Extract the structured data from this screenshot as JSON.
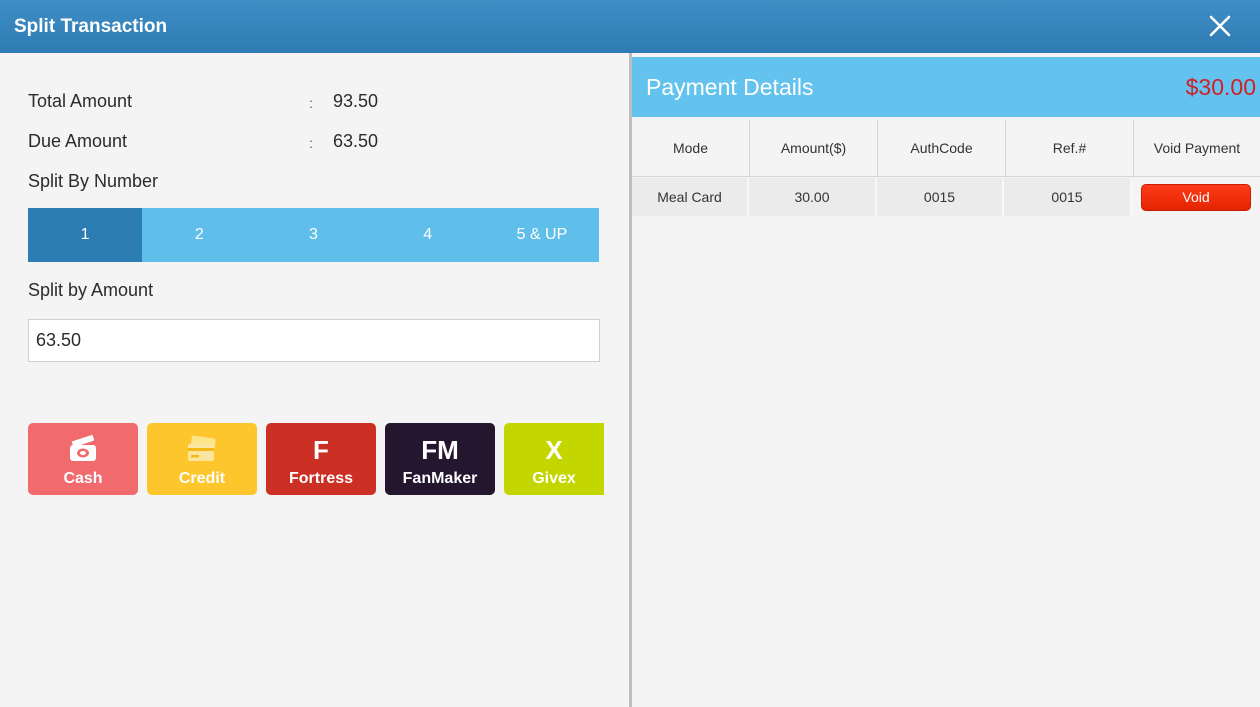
{
  "window": {
    "title": "Split Transaction",
    "close_icon": "close-icon"
  },
  "summary": {
    "total_label": "Total Amount",
    "total_colon": ":",
    "total_value": "93.50",
    "due_label": "Due Amount",
    "due_colon": ":",
    "due_value": "63.50"
  },
  "split_number": {
    "label": "Split By Number",
    "options": [
      "1",
      "2",
      "3",
      "4",
      "5 & UP"
    ],
    "selected": "1"
  },
  "split_amount": {
    "label": "Split by Amount",
    "value": "63.50"
  },
  "payment_methods": [
    {
      "label": "Cash",
      "icon": "cash-icon",
      "color": "#f06a6e"
    },
    {
      "label": "Credit",
      "icon": "credit-card-icon",
      "color": "#fdc62c"
    },
    {
      "label": "Fortress",
      "icon": "fortress-logo",
      "glyph": "F",
      "color": "#cc2f24"
    },
    {
      "label": "FanMaker",
      "icon": "fanmaker-logo",
      "glyph": "FM",
      "color": "#24162f"
    },
    {
      "label": "Givex",
      "icon": "givex-logo",
      "glyph": "X",
      "color": "#c4d600"
    }
  ],
  "payment_details": {
    "title": "Payment Details",
    "total": "$30.00",
    "total_color": "#d0202a",
    "columns": [
      "Mode",
      "Amount($)",
      "AuthCode",
      "Ref.#",
      "Void Payment"
    ],
    "rows": [
      {
        "mode": "Meal Card",
        "amount": "30.00",
        "auth_code": "0015",
        "ref": "0015",
        "action": "Void"
      }
    ]
  },
  "colors": {
    "title_bar": "#2f7bb4",
    "segment_active": "#2d7db5",
    "segment_inactive": "#5fbfea",
    "details_header": "#63c2ee",
    "void_button": "#f02a0a"
  }
}
